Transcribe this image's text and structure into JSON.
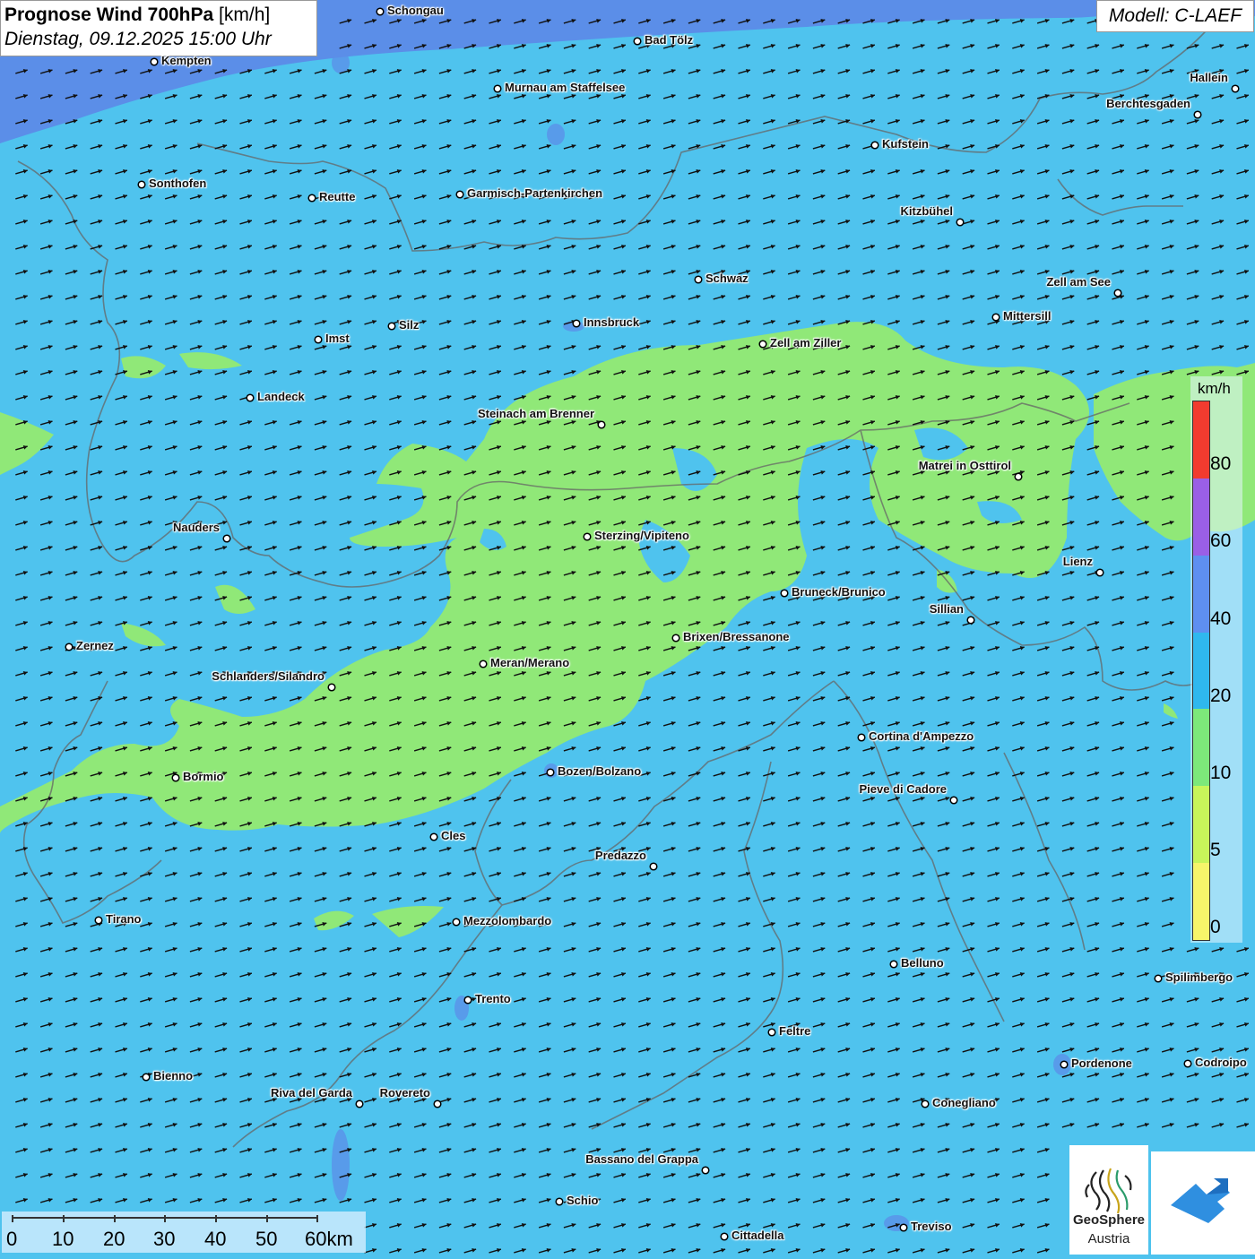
{
  "title": {
    "product": "Prognose Wind 700hPa",
    "unit": " [km/h]",
    "datetime": "Dienstag, 09.12.2025 15:00 Uhr"
  },
  "model": "Modell: C-LAEF",
  "legend": {
    "unit": "km/h",
    "ticks": [
      "80",
      "60",
      "40",
      "20",
      "10",
      "5",
      "0"
    ],
    "colors": [
      "#f23b2f",
      "#9a5fe6",
      "#5e8ff0",
      "#2fb8ee",
      "#7de87a",
      "#c8f55a",
      "#f7f56a"
    ]
  },
  "map": {
    "colors": {
      "wind_10_20": "#4fc3ee",
      "wind_5_10": "#90e878",
      "wind_20_40": "#5b8ee8",
      "lake": "#5b8ee8"
    },
    "wind_direction": "east-northeast"
  },
  "cities": [
    {
      "name": "Schongau"
    },
    {
      "name": "Bad Tölz"
    },
    {
      "name": "Kempten"
    },
    {
      "name": "Murnau am Staffelsee"
    },
    {
      "name": "Hallein"
    },
    {
      "name": "Berchtesgaden"
    },
    {
      "name": "Kufstein"
    },
    {
      "name": "Sonthofen"
    },
    {
      "name": "Reutte"
    },
    {
      "name": "Garmisch-Partenkirchen"
    },
    {
      "name": "Kitzbühel"
    },
    {
      "name": "Schwaz"
    },
    {
      "name": "Zell am See"
    },
    {
      "name": "Mittersill"
    },
    {
      "name": "Silz"
    },
    {
      "name": "Innsbruck"
    },
    {
      "name": "Imst"
    },
    {
      "name": "Zell am Ziller"
    },
    {
      "name": "Landeck"
    },
    {
      "name": "Steinach am Brenner"
    },
    {
      "name": "Matrei in Osttirol"
    },
    {
      "name": "Nauders"
    },
    {
      "name": "Sterzing/Vipiteno"
    },
    {
      "name": "Lienz"
    },
    {
      "name": "Bruneck/Brunico"
    },
    {
      "name": "Sillian"
    },
    {
      "name": "Brixen/Bressanone"
    },
    {
      "name": "Zernez"
    },
    {
      "name": "Meran/Merano"
    },
    {
      "name": "Schlanders/Silandro"
    },
    {
      "name": "Cortina d'Ampezzo"
    },
    {
      "name": "Bozen/Bolzano"
    },
    {
      "name": "Bormio"
    },
    {
      "name": "Pieve di Cadore"
    },
    {
      "name": "Cles"
    },
    {
      "name": "Predazzo"
    },
    {
      "name": "Tirano"
    },
    {
      "name": "Mezzolombardo"
    },
    {
      "name": "Belluno"
    },
    {
      "name": "Spilimbergo"
    },
    {
      "name": "Trento"
    },
    {
      "name": "Feltre"
    },
    {
      "name": "Pordenone"
    },
    {
      "name": "Codroipo"
    },
    {
      "name": "Bienno"
    },
    {
      "name": "Riva del Garda"
    },
    {
      "name": "Rovereto"
    },
    {
      "name": "Conegliano"
    },
    {
      "name": "Bassano del Grappa"
    },
    {
      "name": "Schio"
    },
    {
      "name": "Treviso"
    },
    {
      "name": "Cittadella"
    }
  ],
  "scale": {
    "labels": [
      "0",
      "10",
      "20",
      "30",
      "40",
      "50",
      "60km"
    ]
  },
  "logo": {
    "name": "GeoSphere",
    "sub": "Austria"
  }
}
